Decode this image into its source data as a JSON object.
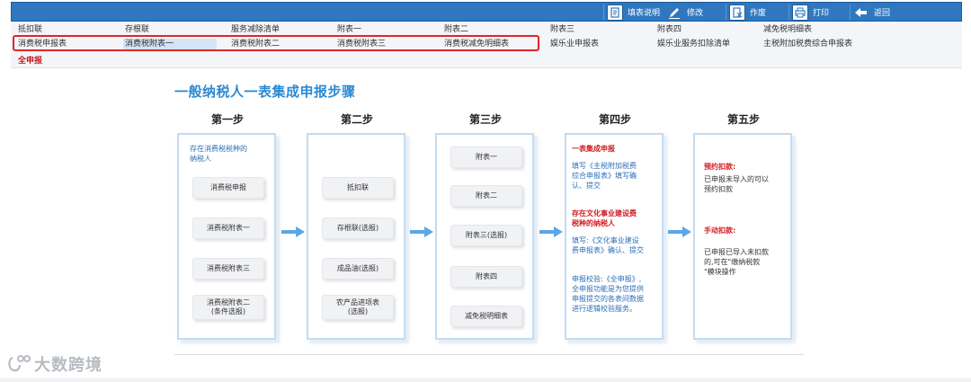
{
  "toolbar": {
    "items": [
      {
        "label": "填表说明",
        "icon": "document-icon"
      },
      {
        "label": "修改",
        "icon": "pencil-icon"
      },
      {
        "label": "作废",
        "icon": "void-document-icon"
      },
      {
        "label": "打印",
        "icon": "printer-icon"
      },
      {
        "label": "返回",
        "icon": "back-arrow-icon"
      }
    ]
  },
  "nav": {
    "row1": [
      "抵扣联",
      "存根联",
      "服务减除清单",
      "附表一",
      "附表二",
      "附表三",
      "附表四",
      "减免税明细表"
    ],
    "row2": [
      "消费税申报表",
      "消费税附表一",
      "消费税附表二",
      "消费税附表三",
      "消费税减免明细表",
      "娱乐业申报表",
      "娱乐业服务扣除清单",
      "主税附加税费综合申报表"
    ],
    "all_submit": "全申报"
  },
  "main": {
    "title": "一般纳税人一表集成申报步骤",
    "steps": [
      {
        "heading": "第一步",
        "intro": [
          "存在消费税税种的",
          "纳税人"
        ],
        "pills": [
          "消费税申报",
          "消费税附表一",
          "消费税附表三",
          "消费税附表二",
          "(条件选报)"
        ]
      },
      {
        "heading": "第二步",
        "pills": [
          "抵扣联",
          "存根联(选报)",
          "成品油(选报)",
          "农产品进项表",
          "(选报)"
        ]
      },
      {
        "heading": "第三步",
        "pills": [
          "附表一",
          "附表二",
          "附表三(选报)",
          "附表四",
          "减免税明细表"
        ]
      },
      {
        "heading": "第四步",
        "s1_title": "一表集成申报",
        "s1_text": [
          "填写《主税附加税费",
          "综合申报表》填写确",
          "认、提交"
        ],
        "s2_title": [
          "存在文化事业建设费",
          "税种的纳税人"
        ],
        "s2_text": [
          "填写:《文化事业建设",
          "费申报表》确认、提交"
        ],
        "s3_text": [
          "申报校验:《全申报》,",
          "全申报功能是为您提供",
          "申报提交的各表间数据",
          "进行逻辑校验服务。"
        ]
      },
      {
        "heading": "第五步",
        "s1_title": "预约扣款:",
        "s1_text": [
          "已申报未导入的可以",
          "预约扣款"
        ],
        "s2_title": "手动扣款:",
        "s2_text": [
          "已申报已导入未扣款",
          "的,可在\"缴纳税款",
          "\"模块操作"
        ]
      }
    ]
  },
  "watermark": "大数跨境",
  "colors": {
    "toolbar": "#2f78c0",
    "title": "#2b8ad4",
    "highlight": "#e0252a",
    "arrow": "#5aa7e6",
    "red_text": "#d11a1f"
  }
}
